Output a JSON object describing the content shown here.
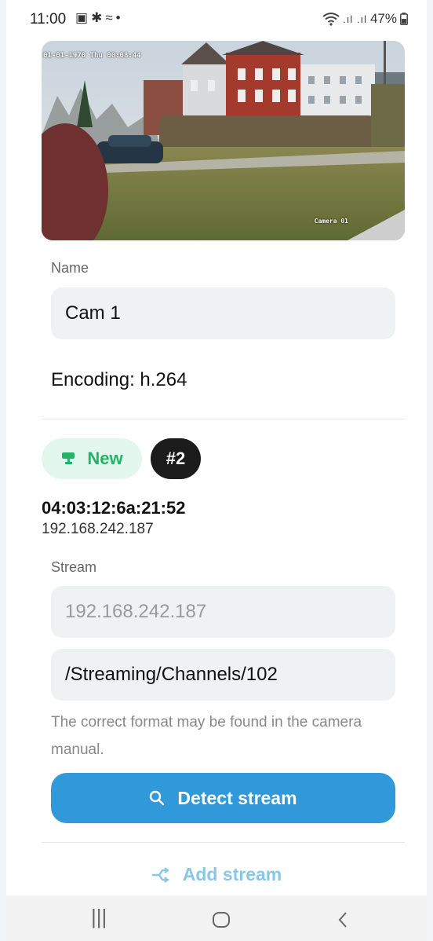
{
  "status_bar": {
    "time": "11:00",
    "battery": "47%"
  },
  "camera": {
    "overlay_timestamp": "01-01-1970 Thu 00:08:44",
    "overlay_label": "Camera 01"
  },
  "form": {
    "name_label": "Name",
    "name_value": "Cam 1",
    "encoding": "Encoding: h.264"
  },
  "device": {
    "status_badge": "New",
    "number_badge": "#2",
    "mac": "04:03:12:6a:21:52",
    "ip": "192.168.242.187"
  },
  "stream": {
    "label": "Stream",
    "host_placeholder": "192.168.242.187",
    "path_value": "/Streaming/Channels/102",
    "help_text": "The correct format may be found in the camera manual.",
    "detect_button": "Detect stream",
    "add_button": "Add stream"
  },
  "colors": {
    "accent": "#3199d9",
    "new_badge_text": "#22b46a",
    "new_badge_bg": "#e4f7ee"
  },
  "icons": [
    "image-icon",
    "gear-icon",
    "wifi-icon",
    "signal-icon",
    "battery-icon",
    "camera-icon",
    "search-icon",
    "add-stream-icon",
    "recents-icon",
    "home-icon",
    "back-icon"
  ]
}
